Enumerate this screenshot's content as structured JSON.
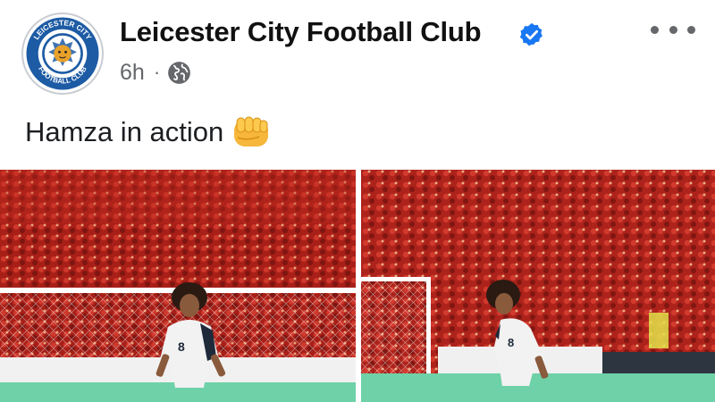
{
  "post": {
    "page_name": "Leicester City Football Club",
    "verified": true,
    "time": "6h",
    "separator": "·",
    "audience_icon": "globe-icon",
    "caption": "Hamza in action",
    "caption_emoji": "oncoming-fist-emoji",
    "logo": {
      "text_top": "LEICESTER CITY",
      "text_bottom": "FOOTBALL CLUB",
      "color": "#1d5ba4"
    },
    "photos": [
      {
        "name": "photo-hamza-1",
        "shirt_number": "8"
      },
      {
        "name": "photo-hamza-2",
        "shirt_number": "8"
      }
    ]
  },
  "colors": {
    "verified_blue": "#1877f2",
    "meta_gray": "#65676b",
    "crowd_red": "#b8231c",
    "pitch_green": "#6fd1a8"
  }
}
